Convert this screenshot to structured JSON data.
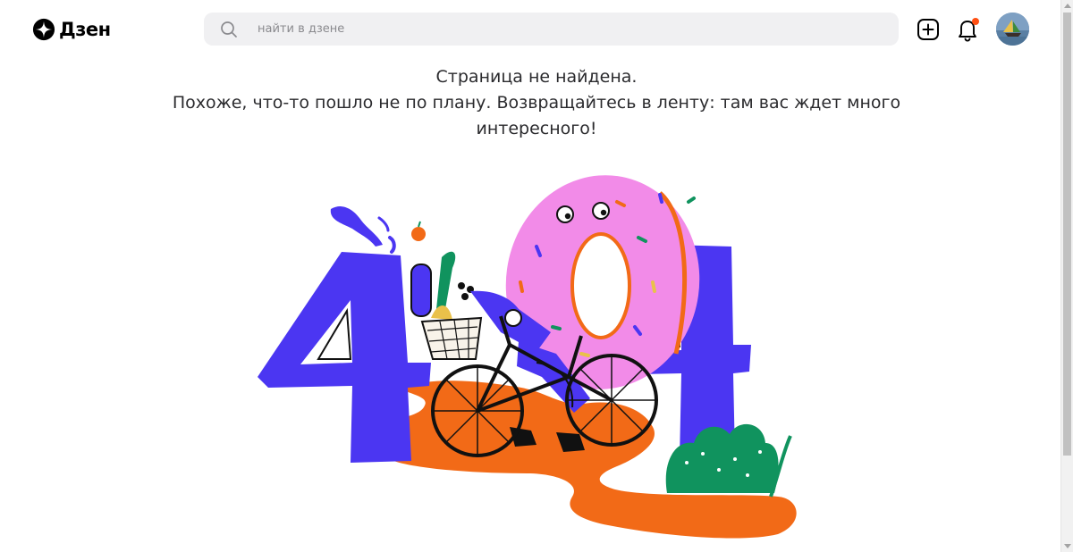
{
  "header": {
    "logo_text": "Дзен",
    "search": {
      "placeholder": "найти в дзене",
      "value": ""
    },
    "notifications": {
      "has_unread": true
    }
  },
  "error": {
    "title": "Страница не найдена.",
    "line2": "Похоже, что-то пошло не по плану. Возвращайтесь в ленту: там вас ждет много",
    "line3": "интересного!"
  },
  "icons": {
    "logo": "zen-star-icon",
    "search": "search-icon",
    "add": "add-post-icon",
    "bell": "bell-icon",
    "avatar": "avatar"
  },
  "colors": {
    "accent_orange": "#ff4f12",
    "digit_blue": "#4b36f2",
    "donut_pink": "#f28be8",
    "road_orange": "#f26a17",
    "bush_green": "#10935e",
    "search_bg": "#f0f0f2"
  }
}
